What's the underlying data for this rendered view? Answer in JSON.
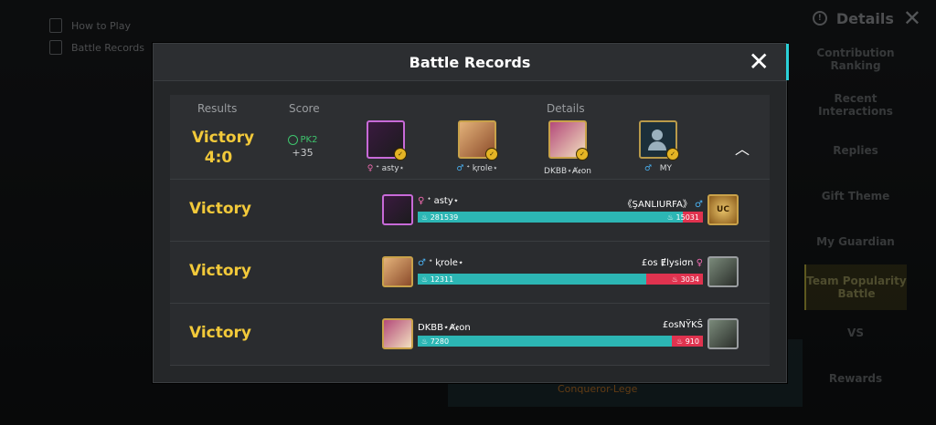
{
  "background": {
    "nav": [
      "How to Play",
      "Battle Records"
    ],
    "details_label": "Details",
    "sidebar": [
      "Contribution Ranking",
      "Recent Interactions",
      "Replies",
      "Gift Theme",
      "My Guardian",
      "Team Popularity Battle",
      "VS",
      "Rewards"
    ],
    "bottom_card_text": "Conqueror-Lege"
  },
  "dialog": {
    "title": "Battle Records",
    "columns": {
      "results": "Results",
      "score": "Score",
      "details": "Details"
    },
    "summary": {
      "result": "Victory",
      "tally": "4:0",
      "mode": "PK2",
      "score_delta": "+35",
      "players": [
        {
          "gender": "♀",
          "name": "ᕀ asty⋆"
        },
        {
          "gender": "♂",
          "name": "ᕀ ⱪrole⋆"
        },
        {
          "gender": "",
          "name": "DKBB⋆Ⱥꬲon"
        },
        {
          "gender": "♂",
          "name": "MY"
        }
      ]
    },
    "matches": [
      {
        "result": "Victory",
        "left_gender": "♀",
        "left_name": "ᕀ asty⋆",
        "right_name": "《ŞANLIURFA》",
        "right_gender": "♂",
        "left_points": "281539",
        "right_points": "15031",
        "left_share": 0.93,
        "right_uc": "UC"
      },
      {
        "result": "Victory",
        "left_gender": "♂",
        "left_name": "ᕀ ⱪrole⋆",
        "right_name": "£os Ɇlysiσn",
        "right_gender": "♀",
        "left_points": "12311",
        "right_points": "3034",
        "left_share": 0.8
      },
      {
        "result": "Victory",
        "left_gender": "",
        "left_name": "DKBB⋆Ⱥꬲon",
        "right_name": "£osNŸKŜ",
        "right_gender": "",
        "left_points": "7280",
        "right_points": "910",
        "left_share": 0.89
      }
    ]
  }
}
